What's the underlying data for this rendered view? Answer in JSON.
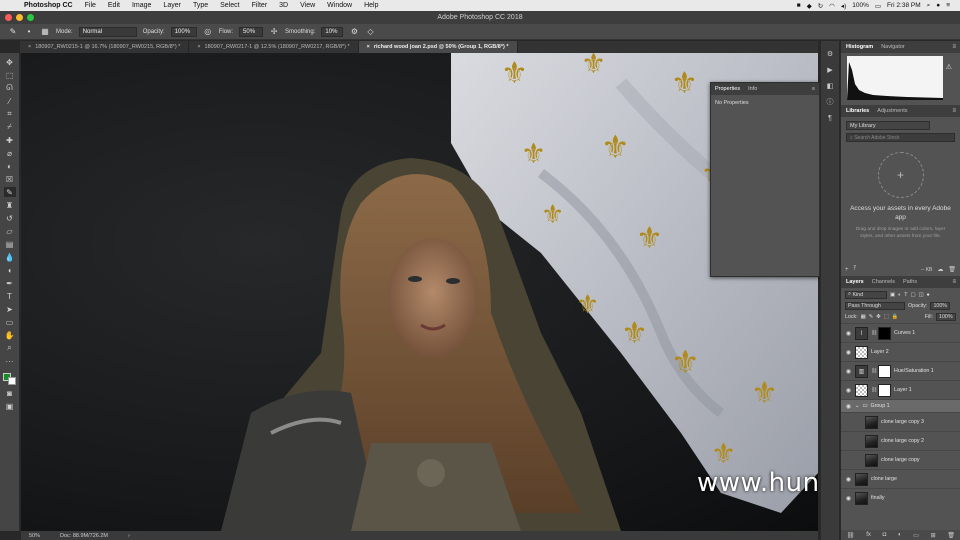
{
  "menubar": {
    "app_name": "Photoshop CC",
    "items": [
      "File",
      "Edit",
      "Image",
      "Layer",
      "Type",
      "Select",
      "Filter",
      "3D",
      "View",
      "Window",
      "Help"
    ],
    "battery": "100%",
    "clock": "Fri 2:38 PM"
  },
  "window": {
    "title": "Adobe Photoshop CC 2018"
  },
  "options": {
    "mode_label": "Mode:",
    "mode_value": "Normal",
    "opacity_label": "Opacity:",
    "opacity_value": "100%",
    "flow_label": "Flow:",
    "flow_value": "50%",
    "smoothing_label": "Smoothing:",
    "smoothing_value": "10%"
  },
  "tabs": [
    {
      "label": "180907_RW0215-1 @ 16.7% (180907_RW0215, RGB/8*) *"
    },
    {
      "label": "180907_RW0217-1 @ 12.5% (180907_RW0217, RGB/8*) *"
    },
    {
      "label": "richard wood joan 2.psd @ 50% (Group 1, RGB/8*) *"
    }
  ],
  "canvas": {
    "watermark": "www.hunls.com"
  },
  "status": {
    "zoom": "50%",
    "doc": "Doc: 88.9M/726.2M"
  },
  "properties": {
    "tab_active": "Properties",
    "tab_other": "Info",
    "message": "No Properties"
  },
  "histogram_panel": {
    "tab_active": "Histogram",
    "tab_other": "Navigator"
  },
  "libraries_panel": {
    "tab_active": "Libraries",
    "tab_other": "Adjustments",
    "library_select": "My Library",
    "search_placeholder": "Search Adobe Stock",
    "empty_title": "Access your assets in every Adobe app",
    "empty_sub": "Drag and drop images or add colors, layer styles, and other assets from your file.",
    "size": "-- KB"
  },
  "layers_panel": {
    "tabs": [
      "Layers",
      "Channels",
      "Paths"
    ],
    "filter_value": "Kind",
    "blend_value": "Pass Through",
    "opacity_label": "Opacity:",
    "opacity_value": "100%",
    "lock_label": "Lock:",
    "fill_label": "Fill:",
    "fill_value": "100%",
    "layers": [
      {
        "name": "Curves 1",
        "kind": "adjustment",
        "visible": true
      },
      {
        "name": "Layer 2",
        "kind": "transparent",
        "visible": true
      },
      {
        "name": "Hue/Saturation 1",
        "kind": "adjustment",
        "visible": true
      },
      {
        "name": "Layer 1",
        "kind": "masked",
        "visible": true
      },
      {
        "name": "Group 1",
        "kind": "group",
        "visible": true
      },
      {
        "name": "clone large copy 3",
        "kind": "photo",
        "visible": false
      },
      {
        "name": "clone large copy 2",
        "kind": "photo",
        "visible": false
      },
      {
        "name": "clone large copy",
        "kind": "photo",
        "visible": false
      },
      {
        "name": "clone large",
        "kind": "photo",
        "visible": true
      },
      {
        "name": "finally",
        "kind": "photo",
        "visible": true
      }
    ]
  }
}
